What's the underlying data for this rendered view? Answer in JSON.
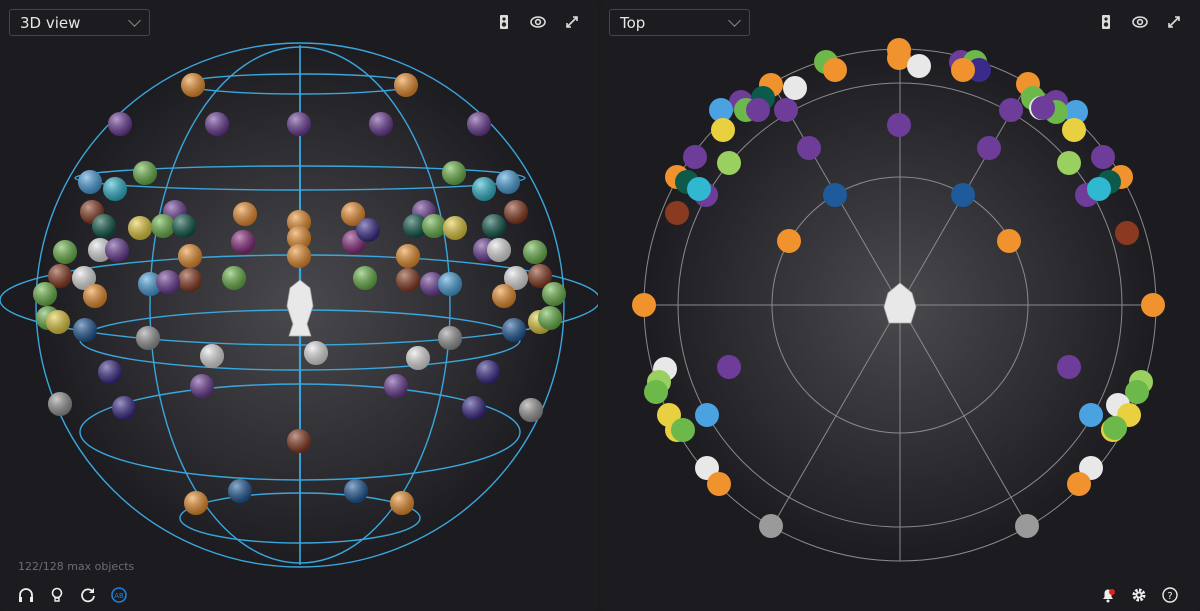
{
  "left_panel": {
    "view_select": {
      "value": "3D view"
    },
    "toolbar": [
      "speaker-icon",
      "eye-icon",
      "expand-icon"
    ],
    "status": "122/128 max objects",
    "bottom_tools": [
      "headphones-icon",
      "lightbulb-icon",
      "reset-icon",
      "ab-compare-icon"
    ]
  },
  "right_panel": {
    "view_select": {
      "value": "Top"
    },
    "toolbar": [
      "speaker-icon",
      "eye-icon",
      "expand-icon"
    ],
    "bottom_tools": [
      "notification-bell-icon",
      "settings-gear-icon",
      "help-icon"
    ]
  },
  "colors": {
    "wireframe": "#3aa6dc",
    "accent": "#1e7fd8",
    "alert": "#e22020",
    "background": "#1c1c20"
  }
}
